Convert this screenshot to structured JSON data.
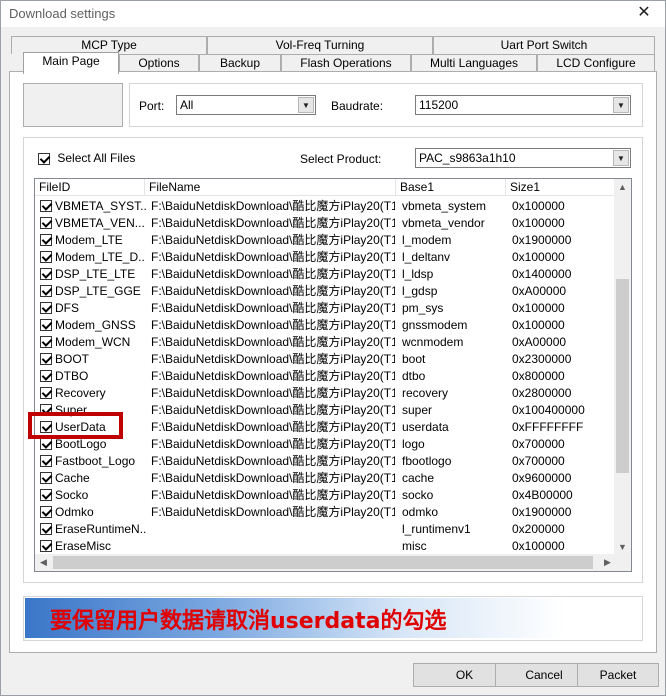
{
  "window": {
    "title": "Download settings",
    "close_label": "✕"
  },
  "tabs_row1": [
    "MCP Type",
    "Vol-Freq Turning",
    "Uart Port Switch"
  ],
  "tabs_row2": [
    "Main Page",
    "Options",
    "Backup",
    "Flash Operations",
    "Multi Languages",
    "LCD Configure"
  ],
  "port": {
    "label": "Port:",
    "value": "All"
  },
  "baudrate": {
    "label": "Baudrate:",
    "value": "115200"
  },
  "select_all": {
    "label": "Select All Files",
    "checked": true
  },
  "product": {
    "label": "Select Product:",
    "value": "PAC_s9863a1h10"
  },
  "list": {
    "columns": [
      "FileID",
      "FileName",
      "Base1",
      "Size1"
    ],
    "rows": [
      {
        "id": "VBMETA_SYST...",
        "file": "F:\\BaiduNetdiskDownload\\酷比魔方iPlay20(T1...",
        "base": "vbmeta_system",
        "size": "0x100000"
      },
      {
        "id": "VBMETA_VEN...",
        "file": "F:\\BaiduNetdiskDownload\\酷比魔方iPlay20(T1...",
        "base": "vbmeta_vendor",
        "size": "0x100000"
      },
      {
        "id": "Modem_LTE",
        "file": "F:\\BaiduNetdiskDownload\\酷比魔方iPlay20(T1...",
        "base": "l_modem",
        "size": "0x1900000"
      },
      {
        "id": "Modem_LTE_D...",
        "file": "F:\\BaiduNetdiskDownload\\酷比魔方iPlay20(T1...",
        "base": "l_deltanv",
        "size": "0x100000"
      },
      {
        "id": "DSP_LTE_LTE",
        "file": "F:\\BaiduNetdiskDownload\\酷比魔方iPlay20(T1...",
        "base": "l_ldsp",
        "size": "0x1400000"
      },
      {
        "id": "DSP_LTE_GGE",
        "file": "F:\\BaiduNetdiskDownload\\酷比魔方iPlay20(T1...",
        "base": "l_gdsp",
        "size": "0xA00000"
      },
      {
        "id": "DFS",
        "file": "F:\\BaiduNetdiskDownload\\酷比魔方iPlay20(T1...",
        "base": "pm_sys",
        "size": "0x100000"
      },
      {
        "id": "Modem_GNSS",
        "file": "F:\\BaiduNetdiskDownload\\酷比魔方iPlay20(T1...",
        "base": "gnssmodem",
        "size": "0x100000"
      },
      {
        "id": "Modem_WCN",
        "file": "F:\\BaiduNetdiskDownload\\酷比魔方iPlay20(T1...",
        "base": "wcnmodem",
        "size": "0xA00000"
      },
      {
        "id": "BOOT",
        "file": "F:\\BaiduNetdiskDownload\\酷比魔方iPlay20(T1...",
        "base": "boot",
        "size": "0x2300000"
      },
      {
        "id": "DTBO",
        "file": "F:\\BaiduNetdiskDownload\\酷比魔方iPlay20(T1...",
        "base": "dtbo",
        "size": "0x800000"
      },
      {
        "id": "Recovery",
        "file": "F:\\BaiduNetdiskDownload\\酷比魔方iPlay20(T1...",
        "base": "recovery",
        "size": "0x2800000"
      },
      {
        "id": "Super",
        "file": "F:\\BaiduNetdiskDownload\\酷比魔方iPlay20(T1...",
        "base": "super",
        "size": "0x100400000"
      },
      {
        "id": "UserData",
        "file": "F:\\BaiduNetdiskDownload\\酷比魔方iPlay20(T1...",
        "base": "userdata",
        "size": "0xFFFFFFFF"
      },
      {
        "id": "BootLogo",
        "file": "F:\\BaiduNetdiskDownload\\酷比魔方iPlay20(T1...",
        "base": "logo",
        "size": "0x700000"
      },
      {
        "id": "Fastboot_Logo",
        "file": "F:\\BaiduNetdiskDownload\\酷比魔方iPlay20(T1...",
        "base": "fbootlogo",
        "size": "0x700000"
      },
      {
        "id": "Cache",
        "file": "F:\\BaiduNetdiskDownload\\酷比魔方iPlay20(T1...",
        "base": "cache",
        "size": "0x9600000"
      },
      {
        "id": "Socko",
        "file": "F:\\BaiduNetdiskDownload\\酷比魔方iPlay20(T1...",
        "base": "socko",
        "size": "0x4B00000"
      },
      {
        "id": "Odmko",
        "file": "F:\\BaiduNetdiskDownload\\酷比魔方iPlay20(T1...",
        "base": "odmko",
        "size": "0x1900000"
      },
      {
        "id": "EraseRuntimeN...",
        "file": "",
        "base": "l_runtimenv1",
        "size": "0x200000"
      },
      {
        "id": "EraseMisc",
        "file": "",
        "base": "misc",
        "size": "0x100000"
      }
    ]
  },
  "annotation": {
    "text": "要保留用户数据请取消userdata的勾选",
    "highlight_color": "#c00000"
  },
  "buttons": {
    "ok": "OK",
    "cancel": "Cancel",
    "packet": "Packet"
  },
  "icons": {
    "dropdown": "▼",
    "up": "▲",
    "down": "▼",
    "left": "◀",
    "right": "▶"
  }
}
